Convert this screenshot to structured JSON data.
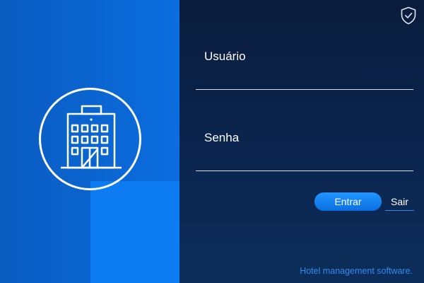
{
  "login": {
    "username_label": "Usuário",
    "username_value": "",
    "password_label": "Senha",
    "password_value": "",
    "enter_button": "Entrar",
    "exit_button": "Sair"
  },
  "footer": {
    "text": "Hotel management software."
  },
  "icons": {
    "logo": "hotel-building-icon",
    "security": "shield-check-icon"
  },
  "colors": {
    "left_panel": "#0a64cf",
    "left_accent": "#0d7cf3",
    "right_panel": "#0b2650",
    "button": "#1a86f5",
    "footer_text": "#2f8cf0"
  }
}
